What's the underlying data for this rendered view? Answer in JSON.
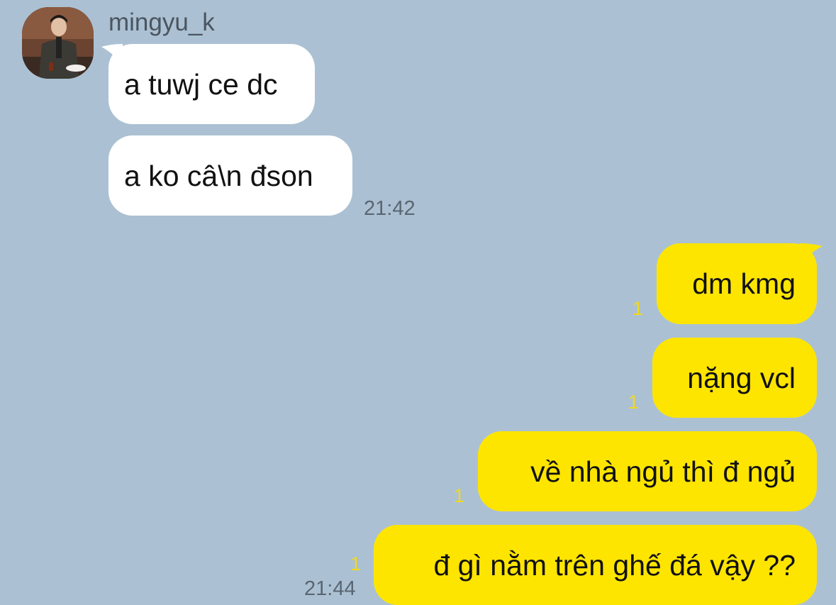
{
  "incoming": {
    "sender_name": "mingyu_k",
    "messages": [
      {
        "text": "a tuwj ce dc"
      },
      {
        "text": "a ko câ\\n đson"
      }
    ],
    "time": "21:42"
  },
  "outgoing": {
    "messages": [
      {
        "text": "dm kmg",
        "unread": "1"
      },
      {
        "text": "nặng vcl",
        "unread": "1"
      },
      {
        "text": "về nhà ngủ thì đ ngủ",
        "unread": "1"
      },
      {
        "text": "đ gì nằm trên ghế đá vậy ??",
        "unread": "1"
      }
    ],
    "time": "21:44"
  },
  "colors": {
    "background": "#abc1d3",
    "incoming_bubble": "#ffffff",
    "outgoing_bubble": "#fee500",
    "unread_count": "#f2d81b"
  }
}
